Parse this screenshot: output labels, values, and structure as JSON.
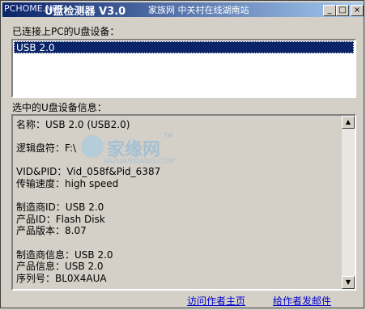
{
  "window": {
    "title": "U盘检测器 V3.0",
    "title_watermark_left": "PCHOME.NET",
    "title_watermark_right": "家族网 中关村在线湖南站",
    "controls": {
      "minimize": "_",
      "maximize": "□",
      "close": "×"
    }
  },
  "devices": {
    "label": "已连接上PC的U盘设备：",
    "items": [
      "USB 2.0"
    ],
    "selected_index": 0
  },
  "info": {
    "label": "选中的U盘设备信息：",
    "lines": [
      "名称：USB 2.0  (USB2.0)",
      "",
      "逻辑盘符：F:\\",
      "",
      "VID&PID：Vid_058f&Pid_6387",
      "传输速度：high speed",
      "",
      "制造商ID：USB 2.0",
      "产品ID：Flash Disk",
      "产品版本：8.07",
      "",
      "制造商信息：USB 2.0",
      "产品信息：USB 2.0",
      "序列号：BL0X4AUA"
    ],
    "watermark": {
      "text": "家缘网",
      "sub": "JIAYUANWANG.COM",
      "tm": "TM"
    }
  },
  "links": {
    "homepage": "访问作者主页",
    "email": "给作者发邮件"
  },
  "colors": {
    "selection": "#0a246a",
    "link": "#0000cc",
    "face": "#d4d0c8"
  }
}
